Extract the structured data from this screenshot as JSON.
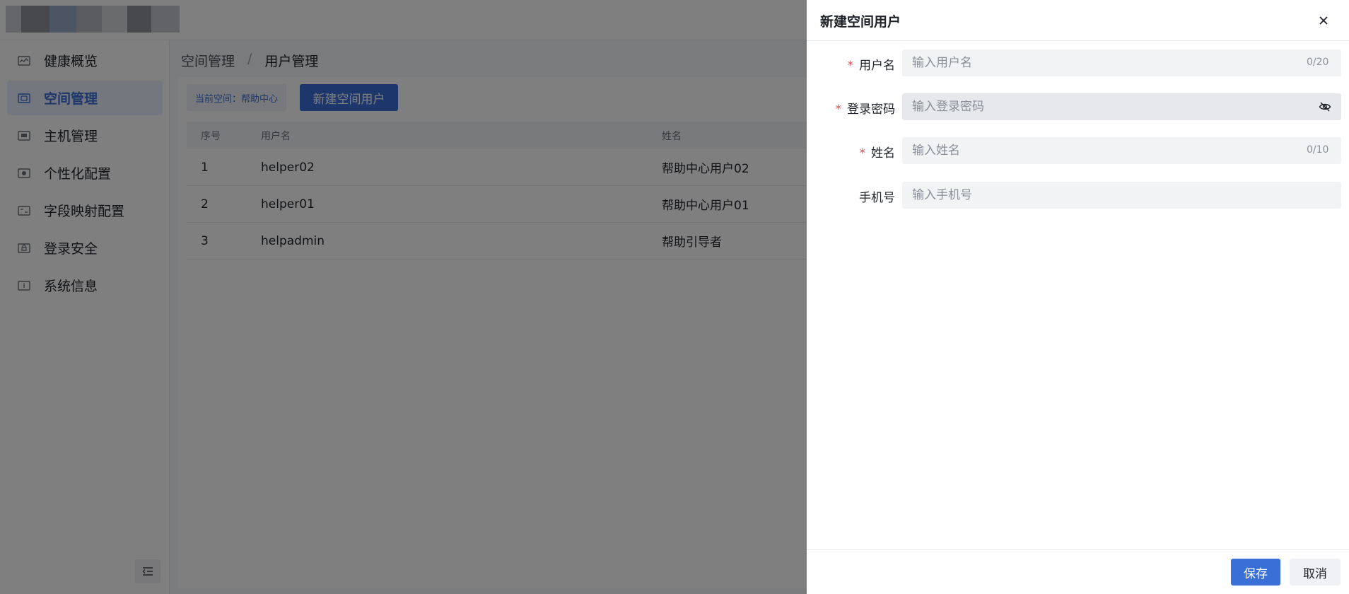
{
  "sidebar": {
    "items": [
      {
        "label": "健康概览",
        "icon": "health-overview-icon"
      },
      {
        "label": "空间管理",
        "icon": "space-manage-icon",
        "active": true
      },
      {
        "label": "主机管理",
        "icon": "host-manage-icon"
      },
      {
        "label": "个性化配置",
        "icon": "personalize-icon"
      },
      {
        "label": "字段映射配置",
        "icon": "field-mapping-icon"
      },
      {
        "label": "登录安全",
        "icon": "login-security-icon"
      },
      {
        "label": "系统信息",
        "icon": "system-info-icon"
      }
    ]
  },
  "breadcrumb": {
    "parent": "空间管理",
    "separator": "/",
    "current": "用户管理"
  },
  "toolbar": {
    "space_tag": "当前空间：帮助中心",
    "new_user_button": "新建空间用户"
  },
  "table": {
    "headers": {
      "index": "序号",
      "username": "用户名",
      "name": "姓名"
    },
    "rows": [
      {
        "index": "1",
        "username": "helper02",
        "name": "帮助中心用户02"
      },
      {
        "index": "2",
        "username": "helper01",
        "name": "帮助中心用户01"
      },
      {
        "index": "3",
        "username": "helpadmin",
        "name": "帮助引导者"
      }
    ]
  },
  "drawer": {
    "title": "新建空间用户",
    "required_mark": "*",
    "fields": {
      "username": {
        "label": "用户名",
        "placeholder": "输入用户名",
        "counter": "0/20"
      },
      "password": {
        "label": "登录密码",
        "placeholder": "输入登录密码"
      },
      "name": {
        "label": "姓名",
        "placeholder": "输入姓名",
        "counter": "0/10"
      },
      "phone": {
        "label": "手机号",
        "placeholder": "输入手机号"
      }
    },
    "save_label": "保存",
    "cancel_label": "取消"
  },
  "colors": {
    "accent": "#3a6fd8",
    "required": "#e34d59",
    "overlay": "rgba(0,0,0,0.5)"
  }
}
